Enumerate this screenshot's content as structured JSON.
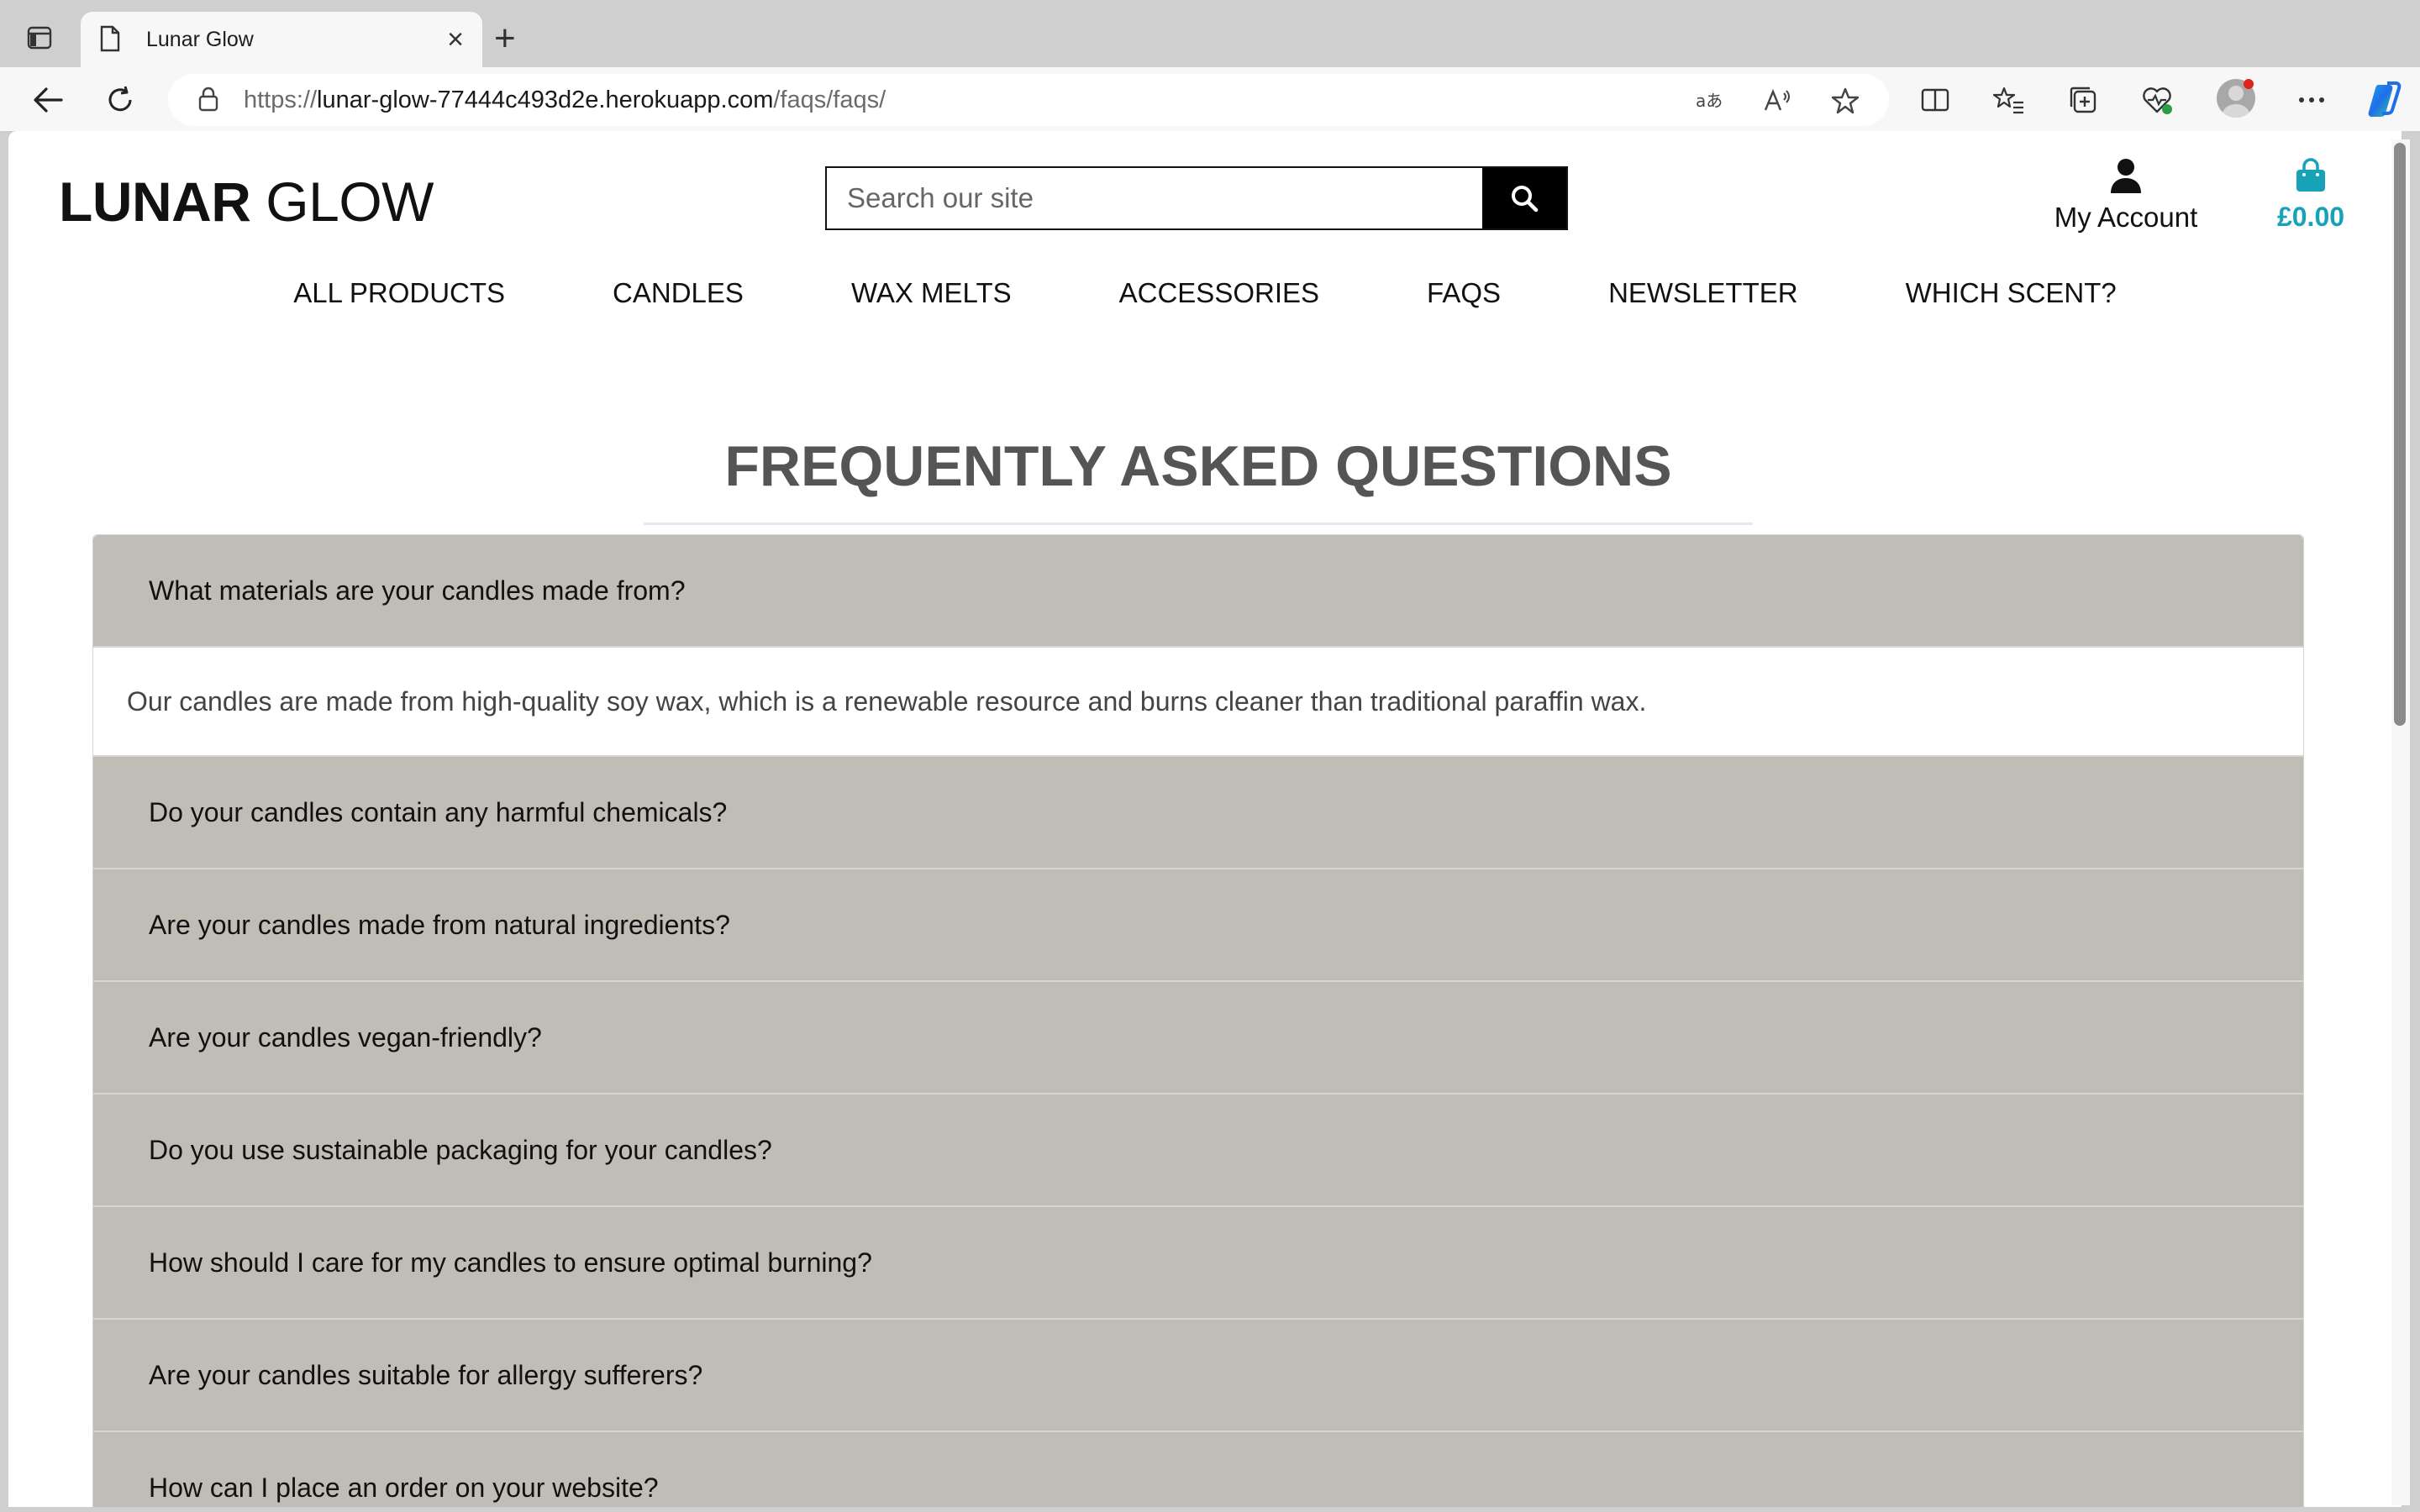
{
  "browser": {
    "tab_title": "Lunar Glow",
    "new_tab_symbol": "+",
    "close_symbol": "×",
    "url_domain_prefix": "https://",
    "url_domain": "lunar-glow-77444c493d2e.herokuapp.com",
    "url_path": "/faqs/faqs/",
    "icons": [
      "tab-actions-icon",
      "page-icon",
      "back-arrow-icon",
      "refresh-icon",
      "lock-icon",
      "translate-icon",
      "read-aloud-icon",
      "favorite-star-icon",
      "split-screen-icon",
      "favorites-icon",
      "collections-icon",
      "browser-essentials-icon",
      "profile-avatar",
      "more-menu-icon",
      "copilot-icon"
    ]
  },
  "site": {
    "logo_bold": "LUNAR",
    "logo_light": " GLOW",
    "search_placeholder": "Search our site",
    "account_label": "My Account",
    "bag_total": "£0.00",
    "accent_color": "#17a2b8"
  },
  "nav": {
    "items": [
      "ALL PRODUCTS",
      "CANDLES",
      "WAX MELTS",
      "ACCESSORIES",
      "FAQS",
      "NEWSLETTER",
      "WHICH SCENT?"
    ]
  },
  "faq": {
    "heading": "FREQUENTLY ASKED QUESTIONS",
    "header_bg": "#c0bdb6",
    "items": [
      {
        "question": "What materials are your candles made from?",
        "answer": "Our candles are made from high-quality soy wax, which is a renewable resource and burns cleaner than traditional paraffin wax.",
        "expanded": true
      },
      {
        "question": "Do your candles contain any harmful chemicals?"
      },
      {
        "question": "Are your candles made from natural ingredients?"
      },
      {
        "question": "Are your candles vegan-friendly?"
      },
      {
        "question": "Do you use sustainable packaging for your candles?"
      },
      {
        "question": "How should I care for my candles to ensure optimal burning?"
      },
      {
        "question": "Are your candles suitable for allergy sufferers?"
      },
      {
        "question": "How can I place an order on your website?"
      }
    ]
  }
}
